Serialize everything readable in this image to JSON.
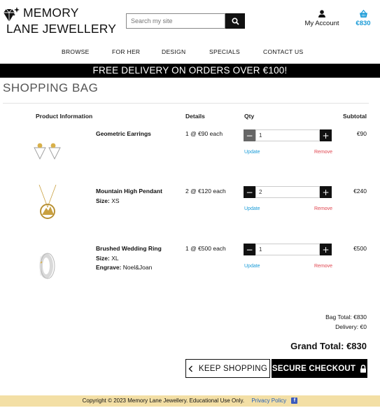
{
  "brand": {
    "line1": "MEMORY",
    "line2": "LANE JEWELLERY"
  },
  "search": {
    "placeholder": "Search my site"
  },
  "account": {
    "label": "My Account"
  },
  "cart": {
    "total": "€830"
  },
  "nav": [
    "BROWSE",
    "FOR HER",
    "DESIGN",
    "SPECIALS",
    "CONTACT US"
  ],
  "banner": "FREE DELIVERY ON ORDERS OVER €100!",
  "page_title": "SHOPPING BAG",
  "table_headers": {
    "product": "Product Information",
    "details": "Details",
    "qty": "Qty",
    "subtotal": "Subtotal"
  },
  "items": [
    {
      "name": "Geometric Earrings",
      "meta": [],
      "details": "1 @ €90 each",
      "qty": "1",
      "update": "Update",
      "remove": "Remove",
      "subtotal": "€90",
      "icon": "earrings-image"
    },
    {
      "name": "Mountain High Pendant",
      "meta": [
        {
          "label": "Size:",
          "value": "XS"
        }
      ],
      "details": "2 @ €120 each",
      "qty": "2",
      "update": "Update",
      "remove": "Remove",
      "subtotal": "€240",
      "icon": "pendant-image"
    },
    {
      "name": "Brushed Wedding Ring",
      "meta": [
        {
          "label": "Size:",
          "value": "XL"
        },
        {
          "label": "Engrave:",
          "value": "Noel&Joan"
        }
      ],
      "details": "1 @ €500 each",
      "qty": "1",
      "update": "Update",
      "remove": "Remove",
      "subtotal": "€500",
      "icon": "ring-image"
    }
  ],
  "totals": {
    "bag": "Bag Total: €830",
    "delivery": "Delivery: €0",
    "grand": "Grand Total: €830"
  },
  "buttons": {
    "keep": "KEEP SHOPPING",
    "checkout": "SECURE CHECKOUT"
  },
  "footer": {
    "copyright": "Copyright © 2023 Memory Lane Jewellery.   Educational Use Only.",
    "privacy": "Privacy Policy"
  },
  "colors": {
    "accent": "#1a9bd7",
    "remove": "#e0454f",
    "footer_bg": "#f3dfa5",
    "banner_bg": "#000000"
  }
}
